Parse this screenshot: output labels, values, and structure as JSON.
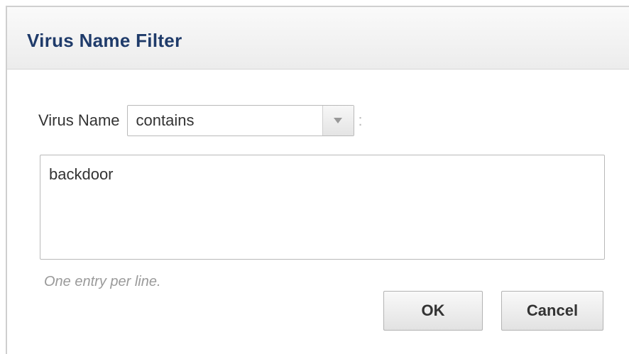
{
  "dialog": {
    "title": "Virus Name Filter",
    "field_label": "Virus Name",
    "match_select": {
      "selected": "contains",
      "arrow_icon": "chevron-down-icon"
    },
    "colon": ":",
    "entries_value": "backdoor",
    "hint": "One entry per line.",
    "ok_label": "OK",
    "cancel_label": "Cancel"
  },
  "colors": {
    "title": "#1f3b6a",
    "hint": "#9a9a9a",
    "arrow": "#999999"
  }
}
